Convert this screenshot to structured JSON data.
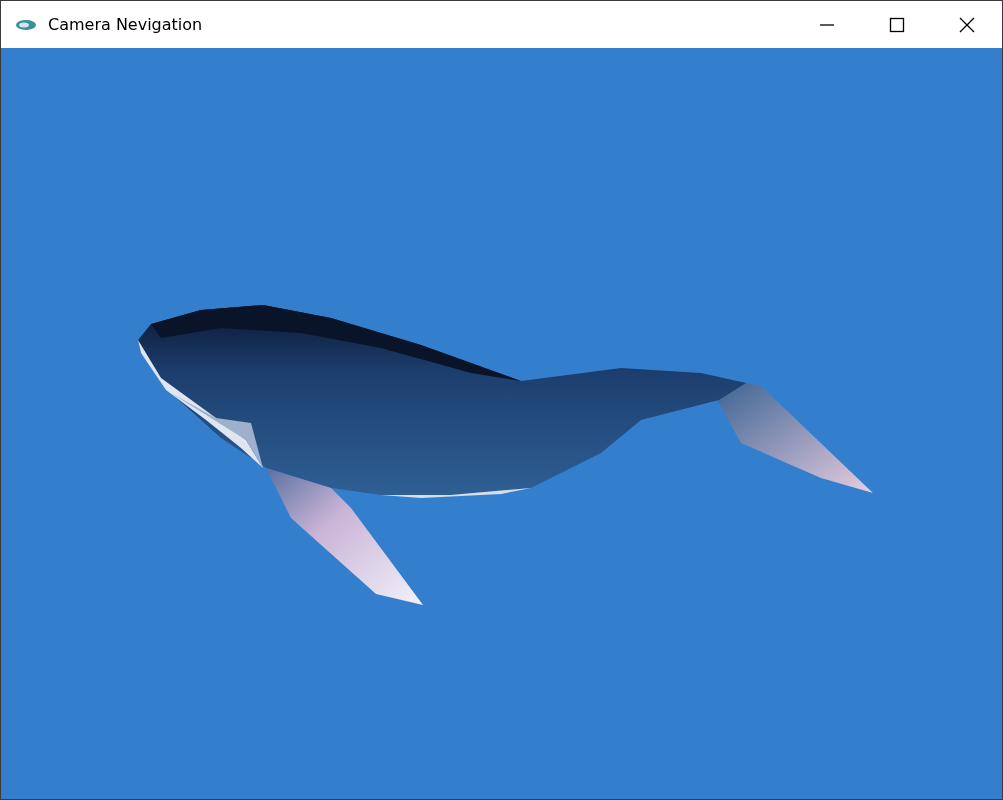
{
  "window": {
    "title": "Camera Nevigation"
  }
}
